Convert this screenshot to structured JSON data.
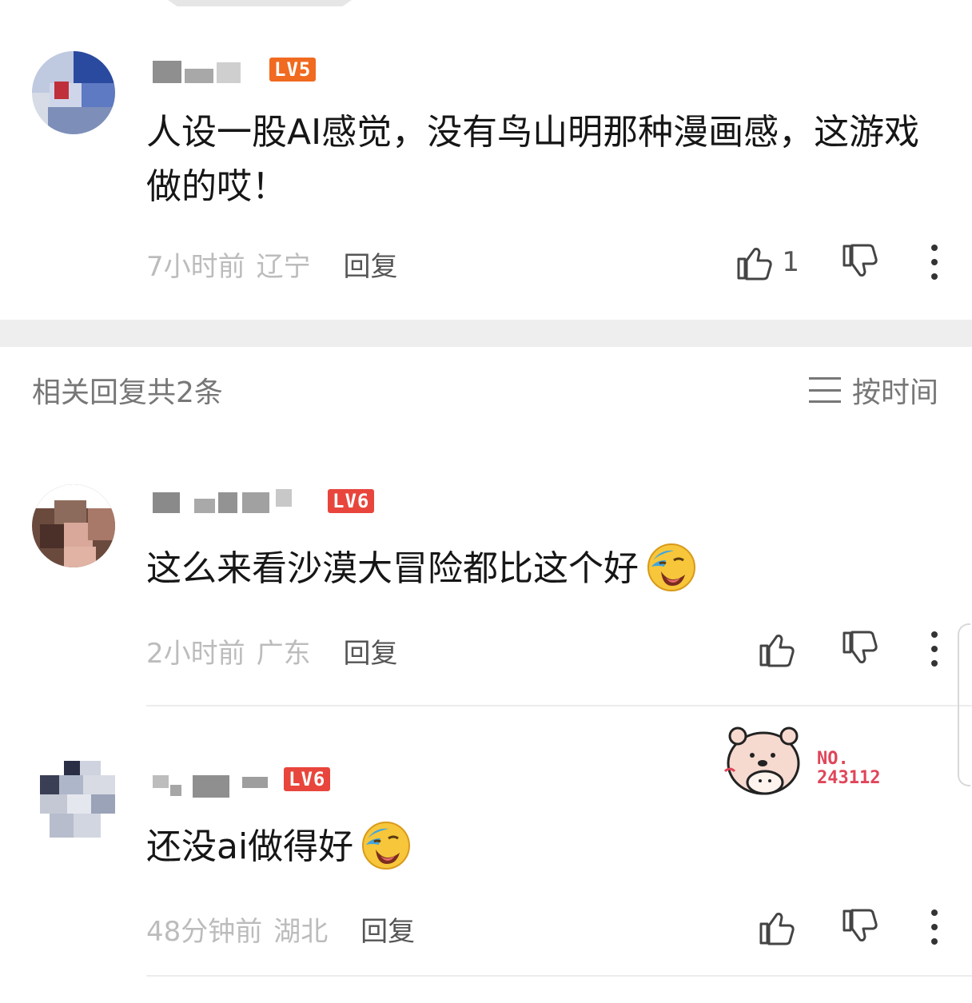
{
  "top_comment": {
    "level": "LV5",
    "level_color": "#f06a20",
    "content": "人设一股AI感觉，没有鸟山明那种漫画感，这游戏做的哎！",
    "time": "7小时前",
    "location": "辽宁",
    "reply_label": "回复",
    "like_count": "1"
  },
  "replies_header": {
    "summary": "相关回复共2条",
    "sort_label": "按时间"
  },
  "replies": [
    {
      "level": "LV6",
      "level_color": "#e8453c",
      "content": "这么来看沙漠大冒险都比这个好",
      "emoji": "laughing-cry-emoji",
      "time": "2小时前",
      "location": "广东",
      "reply_label": "回复"
    },
    {
      "level": "LV6",
      "level_color": "#e8453c",
      "content": "还没ai做得好",
      "emoji": "laughing-cry-emoji",
      "time": "48分钟前",
      "location": "湖北",
      "reply_label": "回复",
      "badge_icon": "bear-badge-icon",
      "badge_text_line1": "NO.",
      "badge_text_line2": "243112"
    }
  ],
  "icons": {
    "like": "thumbs-up-icon",
    "dislike": "thumbs-down-icon",
    "more": "more-vertical-icon",
    "sort": "sort-lines-icon"
  },
  "colors": {
    "accent_red": "#e8453c",
    "text_secondary": "#bcbcbc",
    "band": "#eeeeee"
  }
}
